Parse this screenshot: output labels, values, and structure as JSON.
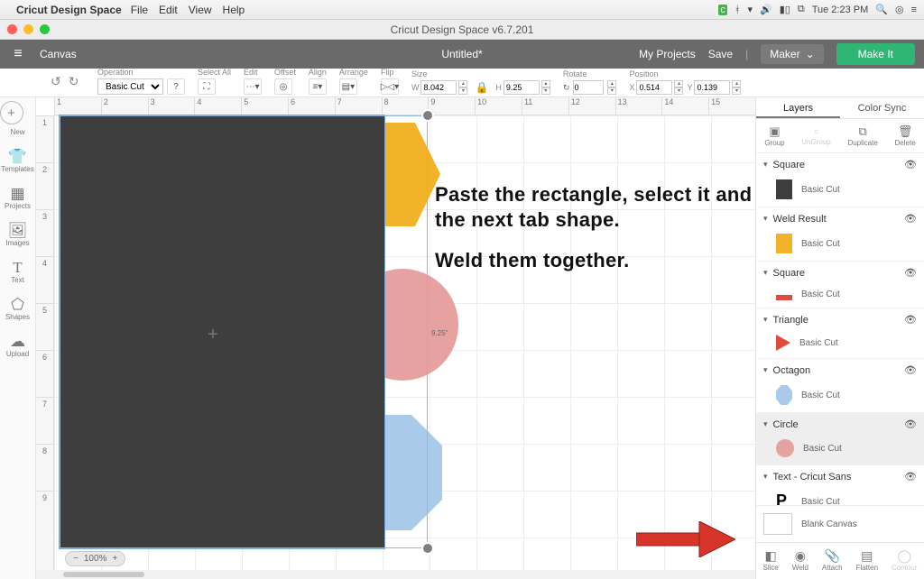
{
  "mac_menu": {
    "app_name": "Cricut Design Space",
    "items": [
      "File",
      "Edit",
      "View",
      "Help"
    ],
    "clock": "Tue 2:23 PM",
    "status_icons": [
      "cricut-green-icon",
      "bluetooth-icon",
      "wifi-icon",
      "volume-icon",
      "battery-icon",
      "dropbox-icon",
      "spotlight-icon",
      "user-icon",
      "menu-icon"
    ]
  },
  "window": {
    "title": "Cricut Design Space  v6.7.201"
  },
  "header": {
    "canvas_label": "Canvas",
    "doc_title": "Untitled*",
    "my_projects": "My Projects",
    "save": "Save",
    "maker": "Maker",
    "make_it": "Make It"
  },
  "options": {
    "operation": {
      "label": "Operation",
      "value": "Basic Cut",
      "help": "?"
    },
    "select_all": "Select All",
    "edit": "Edit",
    "offset": "Offset",
    "align": "Align",
    "arrange": "Arrange",
    "flip": "Flip",
    "size": {
      "label": "Size",
      "w": "8.042",
      "h": "9.25"
    },
    "rotate": {
      "label": "Rotate",
      "value": "0"
    },
    "position": {
      "label": "Position",
      "x": "0.514",
      "y": "0.139"
    }
  },
  "left_tools": [
    {
      "id": "new",
      "label": "New",
      "glyph": "＋"
    },
    {
      "id": "templates",
      "label": "Templates",
      "glyph": "👕"
    },
    {
      "id": "projects",
      "label": "Projects",
      "glyph": "▭"
    },
    {
      "id": "images",
      "label": "Images",
      "glyph": "🖼"
    },
    {
      "id": "text",
      "label": "Text",
      "glyph": "T"
    },
    {
      "id": "shapes",
      "label": "Shapes",
      "glyph": "⬠"
    },
    {
      "id": "upload",
      "label": "Upload",
      "glyph": "⤴"
    }
  ],
  "canvas": {
    "zoom": "100%",
    "dim_label": "9.25\"",
    "h_ticks": [
      "1",
      "2",
      "3",
      "4",
      "5",
      "6",
      "7",
      "8",
      "9",
      "10",
      "11",
      "12",
      "13",
      "14",
      "15"
    ],
    "v_ticks": [
      "1",
      "2",
      "3",
      "4",
      "5",
      "6",
      "7",
      "8",
      "9"
    ],
    "text_block": {
      "p1": "Paste the rectangle, select it and the next tab shape.",
      "p2": "Weld them together."
    }
  },
  "right": {
    "tabs": {
      "layers": "Layers",
      "color_sync": "Color Sync"
    },
    "actions": {
      "group": "Group",
      "ungroup": "UnGroup",
      "duplicate": "Duplicate",
      "delete": "Delete"
    },
    "layers": [
      {
        "name": "Square",
        "sub": "Basic Cut",
        "color": "#3e3e3e",
        "shape": "rect"
      },
      {
        "name": "Weld Result",
        "sub": "Basic Cut",
        "color": "#f2b22a",
        "shape": "rect"
      },
      {
        "name": "Square",
        "sub": "Basic Cut",
        "color": "#e04b3f",
        "shape": "bar"
      },
      {
        "name": "Triangle",
        "sub": "Basic Cut",
        "color": "#e04b3f",
        "shape": "tri"
      },
      {
        "name": "Octagon",
        "sub": "Basic Cut",
        "color": "#a9cbe9",
        "shape": "oct"
      },
      {
        "name": "Circle",
        "sub": "Basic Cut",
        "color": "#e6a2a0",
        "shape": "circ",
        "selected": true
      },
      {
        "name": "Text - Cricut Sans",
        "sub": "Basic Cut",
        "color": "#000",
        "shape": "P"
      }
    ],
    "blank_canvas": "Blank Canvas",
    "bottom_actions": {
      "slice": "Slice",
      "weld": "Weld",
      "attach": "Attach",
      "flatten": "Flatten",
      "contour": "Contour"
    }
  }
}
